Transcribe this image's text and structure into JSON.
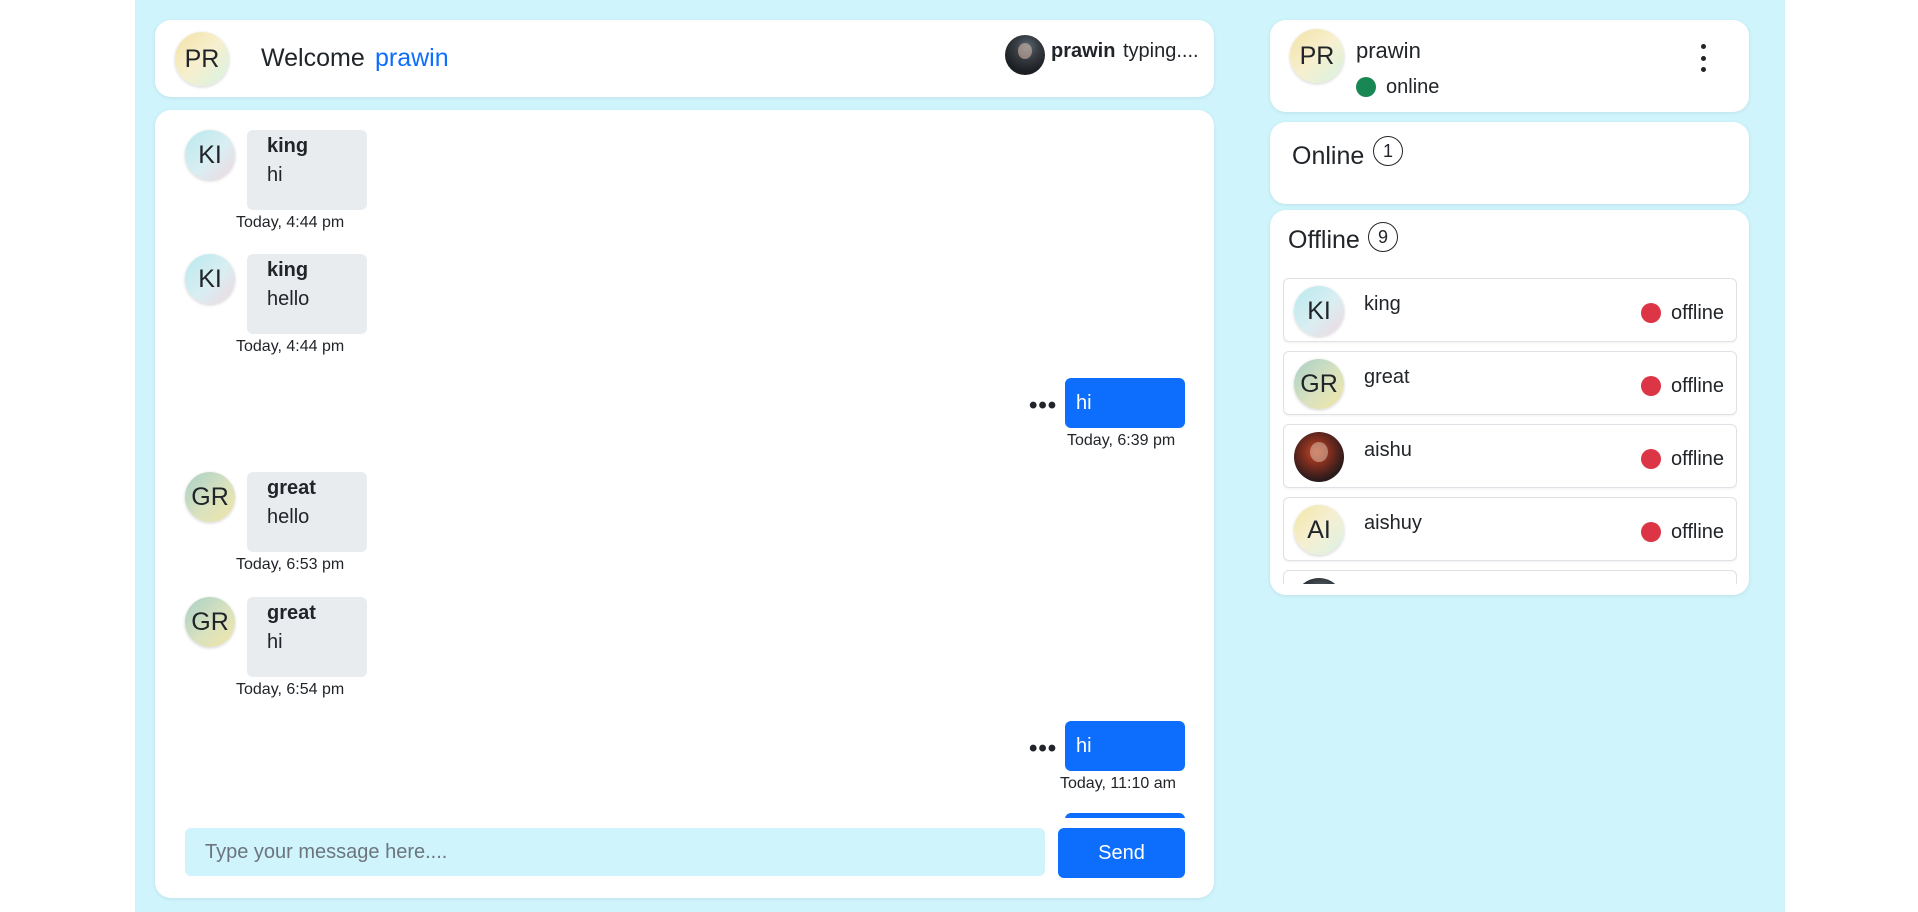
{
  "header": {
    "avatar_initials": "PR",
    "welcome_label": "Welcome",
    "username": "prawin",
    "typing_user": "prawin",
    "typing_label": "typing...."
  },
  "messages": [
    {
      "type": "in",
      "initials": "KI",
      "sender": "king",
      "text": "hi",
      "time": "Today, 4:44 pm"
    },
    {
      "type": "in",
      "initials": "KI",
      "sender": "king",
      "text": "hello",
      "time": "Today, 4:44 pm"
    },
    {
      "type": "out",
      "text": "hi",
      "time": "Today, 6:39 pm",
      "menu_icon": "ellipsis-icon"
    },
    {
      "type": "in",
      "initials": "GR",
      "sender": "great",
      "text": "hello",
      "time": "Today, 6:53 pm"
    },
    {
      "type": "in",
      "initials": "GR",
      "sender": "great",
      "text": "hi",
      "time": "Today, 6:54 pm"
    },
    {
      "type": "out",
      "text": "hi",
      "time": "Today, 11:10 am",
      "menu_icon": "ellipsis-icon"
    }
  ],
  "composer": {
    "placeholder": "Type your message here....",
    "send_label": "Send"
  },
  "profile": {
    "initials": "PR",
    "name": "prawin",
    "status": "online",
    "status_color": "#198754",
    "menu_icon": "kebab-menu-icon"
  },
  "online_section": {
    "title": "Online",
    "count": "1"
  },
  "offline_section": {
    "title": "Offline",
    "count": "9",
    "users": [
      {
        "initials": "KI",
        "name": "king",
        "status": "offline"
      },
      {
        "initials": "GR",
        "name": "great",
        "status": "offline"
      },
      {
        "initials": "",
        "name": "aishu",
        "status": "offline",
        "avatar": "photo"
      },
      {
        "initials": "AI",
        "name": "aishuy",
        "status": "offline"
      }
    ]
  },
  "colors": {
    "background": "#cff4fc",
    "primary": "#0d6efd",
    "online": "#198754",
    "offline": "#dc3545",
    "bubble_in": "#e9ecef"
  }
}
